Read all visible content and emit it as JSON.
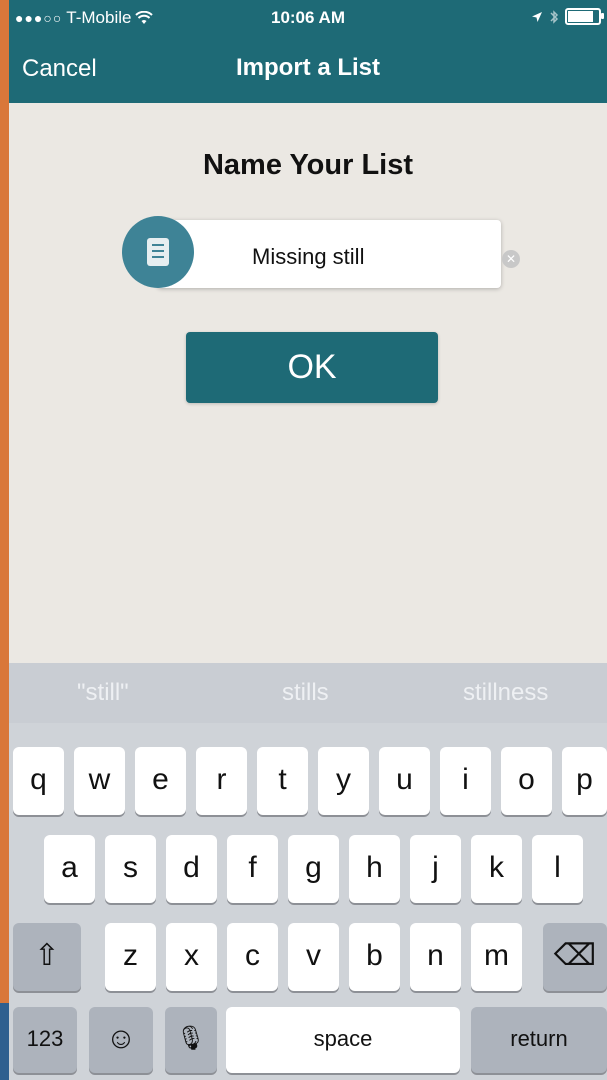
{
  "status_bar": {
    "carrier": "T-Mobile",
    "signal_dots": "●●●○○",
    "wifi": "wifi-icon",
    "time": "10:06 AM",
    "location": "location-arrow-icon",
    "bluetooth": "bluetooth-icon",
    "battery_level": 0.9
  },
  "nav": {
    "cancel_label": "Cancel",
    "title": "Import a List"
  },
  "form": {
    "title": "Name Your List",
    "list_icon": "list-icon",
    "name_value": "Missing still",
    "clear_icon": "clear-icon",
    "ok_label": "OK"
  },
  "keyboard": {
    "suggestions": [
      "\"still\"",
      "stills",
      "stillness"
    ],
    "row1": [
      "q",
      "w",
      "e",
      "r",
      "t",
      "y",
      "u",
      "i",
      "o",
      "p"
    ],
    "row2": [
      "a",
      "s",
      "d",
      "f",
      "g",
      "h",
      "j",
      "k",
      "l"
    ],
    "row3": [
      "z",
      "x",
      "c",
      "v",
      "b",
      "n",
      "m"
    ],
    "shift_glyph": "⇧",
    "delete_glyph": "⌫",
    "numbers_label": "123",
    "emoji_glyph": "☺",
    "mic_glyph": "🎙",
    "space_label": "space",
    "return_label": "return"
  },
  "colors": {
    "brand": "#1e6a76",
    "icon_circle": "#3e8396",
    "background": "#ebe8e3"
  }
}
